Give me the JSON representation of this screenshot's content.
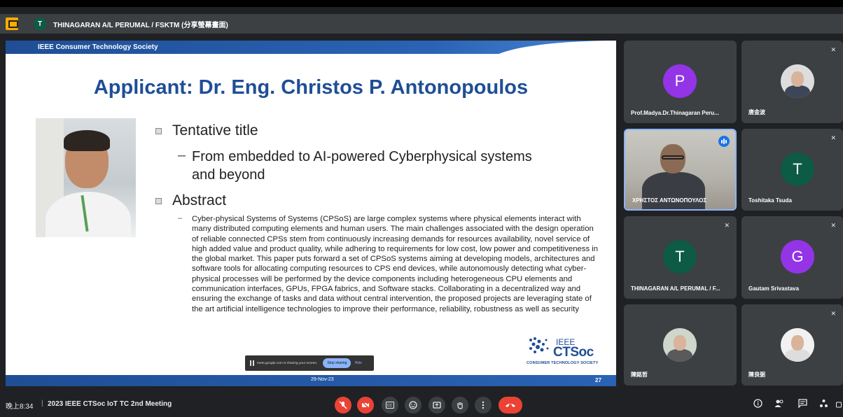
{
  "presenter": {
    "avatar_letter": "T",
    "label": "THINAGARAN A/L PERUMAL / FSKTM (分享螢幕畫面)"
  },
  "slide": {
    "header": "IEEE Consumer Technology Society",
    "title": "Applicant: Dr. Eng. Christos P. Antonopoulos",
    "bullet1": "Tentative title",
    "sub1_dash": "–",
    "sub1": "From embedded to AI-powered Cyberphysical systems and beyond",
    "bullet2": "Abstract",
    "abstract_dash": "–",
    "abstract": "Cyber-physical Systems of Systems (CPSoS) are large complex systems where physical elements interact with many distributed computing elements and human users. The main challenges associated with the design operation of reliable connected CPSs stem from continuously increasing demands for resources availability, novel service of high added value and product quality, while adhering to requirements for low cost, low power and competitiveness in the global market. This paper puts forward a set of CPSoS systems aiming at developing models, architectures and software tools for allocating computing resources to CPS end devices, while autonomously detecting what cyber-physical processes will be performed by the device components including heterogeneous CPU elements and communication interfaces, GPUs, FPGA fabrics, and Software stacks. Collaborating in a decentralized way and ensuring the exchange of tasks and data without central intervention, the proposed projects are leveraging state of the art artificial intelligence technologies to improve their performance, reliability, robustness as well as security",
    "logo_ieee": "IEEE",
    "logo_main": "CTSoc",
    "logo_sub": "CONSUMER TECHNOLOGY SOCIETY",
    "date": "29-Nov-23",
    "page": "27"
  },
  "sharing_notice": {
    "text": "meet.google.com is sharing your screen.",
    "stop": "Stop sharing",
    "hide": "Hide"
  },
  "participants": [
    {
      "name": "Prof.Madya.Dr.Thinagaran Peru...",
      "letter": "P",
      "color": "#9334e6"
    },
    {
      "name": "唐金波",
      "letter": "",
      "color": "#ffffff"
    },
    {
      "name": "ΧΡΗΣΤΟΣ ΑΝΤΩΝΟΠΟΥΛΟΣ",
      "letter": "",
      "color": "#1a73e8"
    },
    {
      "name": "Toshitaka Tsuda",
      "letter": "T",
      "color": "#0d5a45"
    },
    {
      "name": "THINAGARAN A/L PERUMAL / F...",
      "letter": "T",
      "color": "#0d5a45"
    },
    {
      "name": "Gautam Srivastava",
      "letter": "G",
      "color": "#9334e6"
    },
    {
      "name": "陳銘哲",
      "letter": "",
      "color": "#ffffff"
    },
    {
      "name": "陳良弼",
      "letter": "",
      "color": "#ffffff"
    }
  ],
  "bottom": {
    "time": "晚上8:34",
    "sep": "|",
    "meeting_title": "2023 IEEE CTSoc IoT TC 2nd Meeting"
  },
  "colors": {
    "ieee_blue": "#1f4e96",
    "red": "#ea4335",
    "tile_bg": "#3c4043"
  },
  "icons": [
    "present-icon",
    "mic-off-icon",
    "camera-off-icon",
    "captions-icon",
    "emoji-icon",
    "present-screen-icon",
    "raise-hand-icon",
    "more-options-icon",
    "end-call-icon",
    "info-icon",
    "people-icon",
    "chat-icon",
    "activities-icon",
    "lock-icon"
  ]
}
